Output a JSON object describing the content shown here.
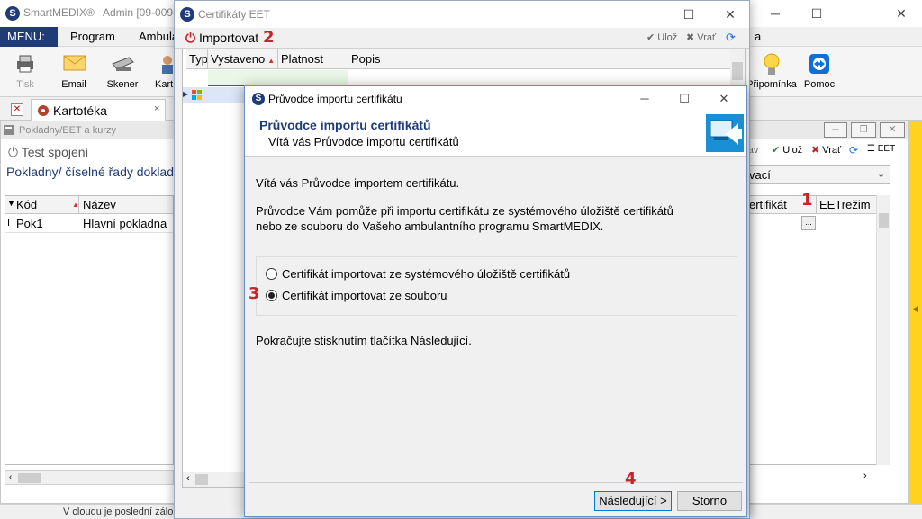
{
  "main": {
    "title": "SmartMEDIX®",
    "user": "Admin [09-009-",
    "menu": [
      "MENU:",
      "Program",
      "Ambula"
    ],
    "menu_right": "a",
    "toolbar": [
      {
        "label": "Tisk",
        "icon": "printer-icon"
      },
      {
        "label": "Email",
        "icon": "envelope-icon"
      },
      {
        "label": "Skener",
        "icon": "scanner-icon"
      },
      {
        "label": "Kart",
        "icon": "person-icon"
      }
    ],
    "toolbar_right": [
      {
        "label": "Připomínka",
        "icon": "lightbulb-icon"
      },
      {
        "label": "Pomoc",
        "icon": "teamviewer-icon"
      }
    ],
    "tab_label": "Kartotéka",
    "subwin_title": "Pokladny/EET a kurzy",
    "test_connection": "Test spojení",
    "breadcrumb": "Pokladny/ číselné řady dokladů",
    "table": {
      "headers": [
        "Kód",
        "Název"
      ],
      "rows": [
        {
          "code": "Pok1",
          "name": "Hlavní pokladna"
        }
      ],
      "right_headers": [
        "ertifikát",
        "EETrežim"
      ]
    },
    "right_toolbar": {
      "oprav": "prav",
      "save": "Ulož",
      "revert": "Vrať",
      "eet": "EET"
    },
    "combo_value": "vací",
    "status": "V cloudu je poslední záloha"
  },
  "cert": {
    "title": "Certifikáty EET",
    "import_label": "Importovat",
    "save": "Ulož",
    "revert": "Vrať",
    "columns": [
      "Typ",
      "Vystaveno",
      "Platnost",
      "Popis"
    ]
  },
  "wizard": {
    "title": "Průvodce importu certifikátu",
    "header_title": "Průvodce importu certifikátů",
    "header_subtitle": "Vítá vás Průvodce importu certifikátů",
    "welcome": "Vítá vás Průvodce importem certifikátu.",
    "desc1": "Průvodce Vám pomůže při importu certifikátu ze systémového úložiště certifikátů",
    "desc2": "nebo ze souboru do Vašeho ambulantního programu SmartMEDIX.",
    "option1": "Certifikát importovat ze systémového úložiště certifikátů",
    "option2": "Certifikát importovat ze souboru",
    "continue_text": "Pokračujte stisknutím tlačítka Následující.",
    "next_button": "Následující >",
    "cancel_button": "Storno"
  },
  "annotations": {
    "n1": "1",
    "n2": "2",
    "n3": "3",
    "n4": "4"
  },
  "colors": {
    "accent": "#1f3b78",
    "annotation": "#c8222a",
    "rail": "#ffd21e",
    "header_title": "#1f3b78"
  }
}
